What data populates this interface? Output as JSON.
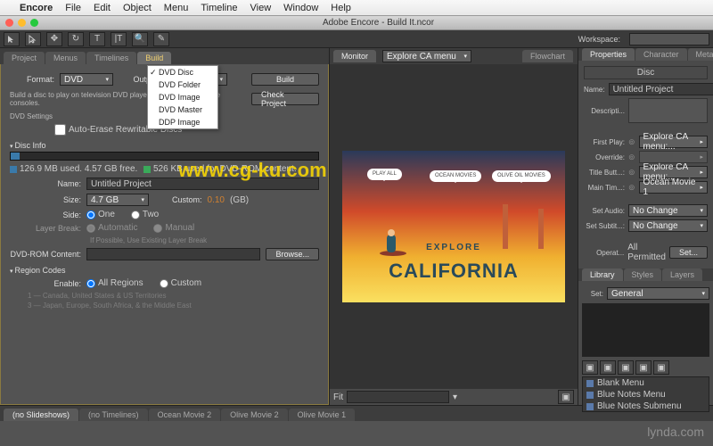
{
  "menubar": {
    "app": "Encore",
    "items": [
      "File",
      "Edit",
      "Object",
      "Menu",
      "Timeline",
      "View",
      "Window",
      "Help"
    ]
  },
  "window": {
    "title": "Adobe Encore - Build It.ncor"
  },
  "workspace": {
    "label": "Workspace:"
  },
  "left_tabs": [
    "Project",
    "Menus",
    "Timelines",
    "Build"
  ],
  "left_active_tab": "Build",
  "build": {
    "format_label": "Format:",
    "format_value": "DVD",
    "output_label": "Output:",
    "output_value": "DVD Disc",
    "output_options": [
      "DVD Disc",
      "DVD Folder",
      "DVD Image",
      "DVD Master",
      "DDP Image"
    ],
    "build_btn": "Build",
    "check_btn": "Check Project",
    "hint": "Build a disc to play on television DVD players, computers, or game consoles.",
    "dvd_settings": "DVD Settings",
    "auto_erase": "Auto-Erase Rewritable Discs",
    "disc_info": "Disc Info",
    "legend1": "126.9 MB used. 4.57 GB free.",
    "legend2": "526 KB used for DVD-ROM content.",
    "name_label": "Name:",
    "name_value": "Untitled Project",
    "size_label": "Size:",
    "size_value": "4.7 GB",
    "custom_label": "Custom:",
    "custom_value": "0.10",
    "custom_unit": "(GB)",
    "side_label": "Side:",
    "side_one": "One",
    "side_two": "Two",
    "layerbreak_label": "Layer Break:",
    "lb_auto": "Automatic",
    "lb_manual": "Manual",
    "lb_hint": "If Possible, Use Existing Layer Break",
    "dvdrom_label": "DVD-ROM Content:",
    "browse_btn": "Browse...",
    "region_hdr": "Region Codes",
    "enable_label": "Enable:",
    "enable_all": "All Regions",
    "enable_custom": "Custom",
    "regions": [
      "1 — Canada, United States & US Territories",
      "3 — Japan, Europe, South Africa, & the Middle East",
      "…"
    ]
  },
  "monitor": {
    "tab": "Monitor",
    "menu_label": "Explore CA menu",
    "fit_label": "Fit"
  },
  "preview": {
    "b1": "PLAY ALL",
    "b2": "OCEAN MOVIES",
    "b3": "OLIVE OIL MOVIES",
    "t1": "EXPLORE",
    "t2": "CALIFORNIA"
  },
  "flowchart_tab": "Flowchart",
  "right_tabs": [
    "Properties",
    "Character",
    "Metadata"
  ],
  "props": {
    "header": "Disc",
    "name_label": "Name:",
    "name_value": "Untitled Project",
    "desc_label": "Descripti...",
    "first_label": "First Play:",
    "first_value": "Explore CA menu:...",
    "override_label": "Override:",
    "title_label": "Title Butt...:",
    "title_value": "Explore CA menu:...",
    "main_label": "Main Tim...:",
    "main_value": "Ocean Movie 1",
    "audio_label": "Set Audio:",
    "audio_value": "No Change",
    "sub_label": "Set Subtit...:",
    "sub_value": "No Change",
    "op_label": "Operat...",
    "op_value": "All Permitted",
    "set_btn": "Set..."
  },
  "lib_tabs": [
    "Library",
    "Styles",
    "Layers"
  ],
  "library": {
    "set_label": "Set:",
    "set_value": "General",
    "items": [
      "Blank Menu",
      "Blue Notes Menu",
      "Blue Notes Submenu"
    ]
  },
  "bottom_tabs": [
    "(no Slideshows)",
    "(no Timelines)",
    "Ocean Movie 2",
    "Olive Movie 2",
    "Olive Movie 1"
  ],
  "watermark": "www.cg-ku.com",
  "watermark2": "lynda.com"
}
